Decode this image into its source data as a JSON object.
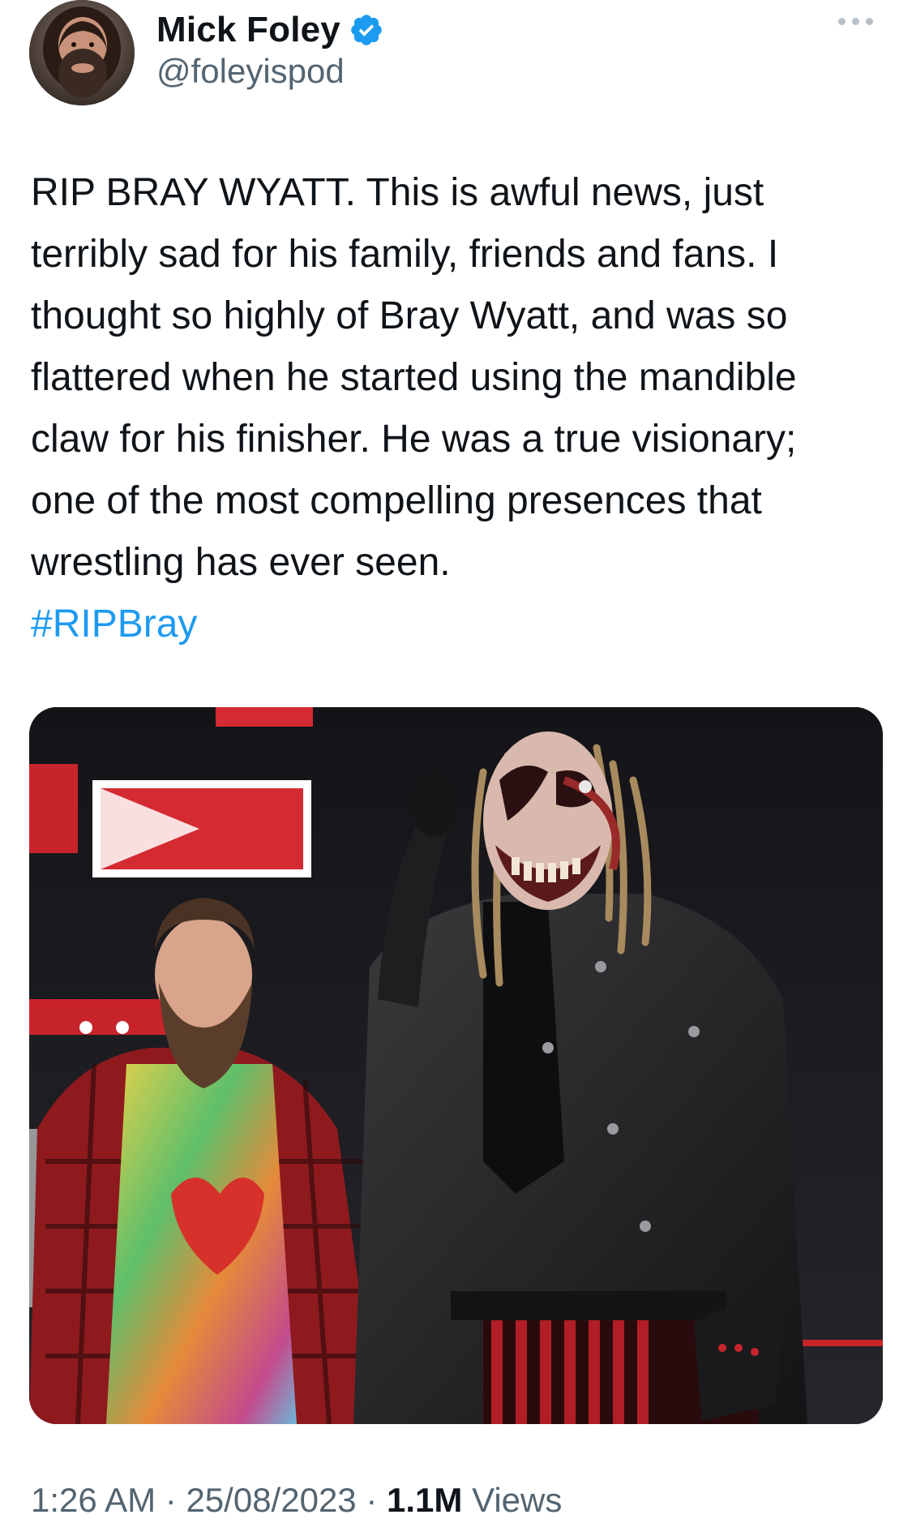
{
  "author": {
    "display_name": "Mick Foley",
    "handle": "@foleyispod",
    "verified": true,
    "avatar_icon": "profile-photo"
  },
  "tweet": {
    "text": "RIP BRAY WYATT. This is awful news, just\nterribly sad for his family, friends and fans. I\nthought so highly of Bray Wyatt, and was so\nflattered when he started using the mandible\nclaw for his finisher. He was a true visionary;\none of the most compelling presences that\nwrestling has ever seen.",
    "hashtag": "#RIPBray",
    "media_description": "photo"
  },
  "meta": {
    "time": "1:26 AM",
    "date": "25/08/2023",
    "separator": "·",
    "views_count": "1.1M",
    "views_label": "Views"
  },
  "colors": {
    "link": "#1d9bf0",
    "secondary_text": "#536471",
    "verified_badge": "#1d9bf0"
  }
}
